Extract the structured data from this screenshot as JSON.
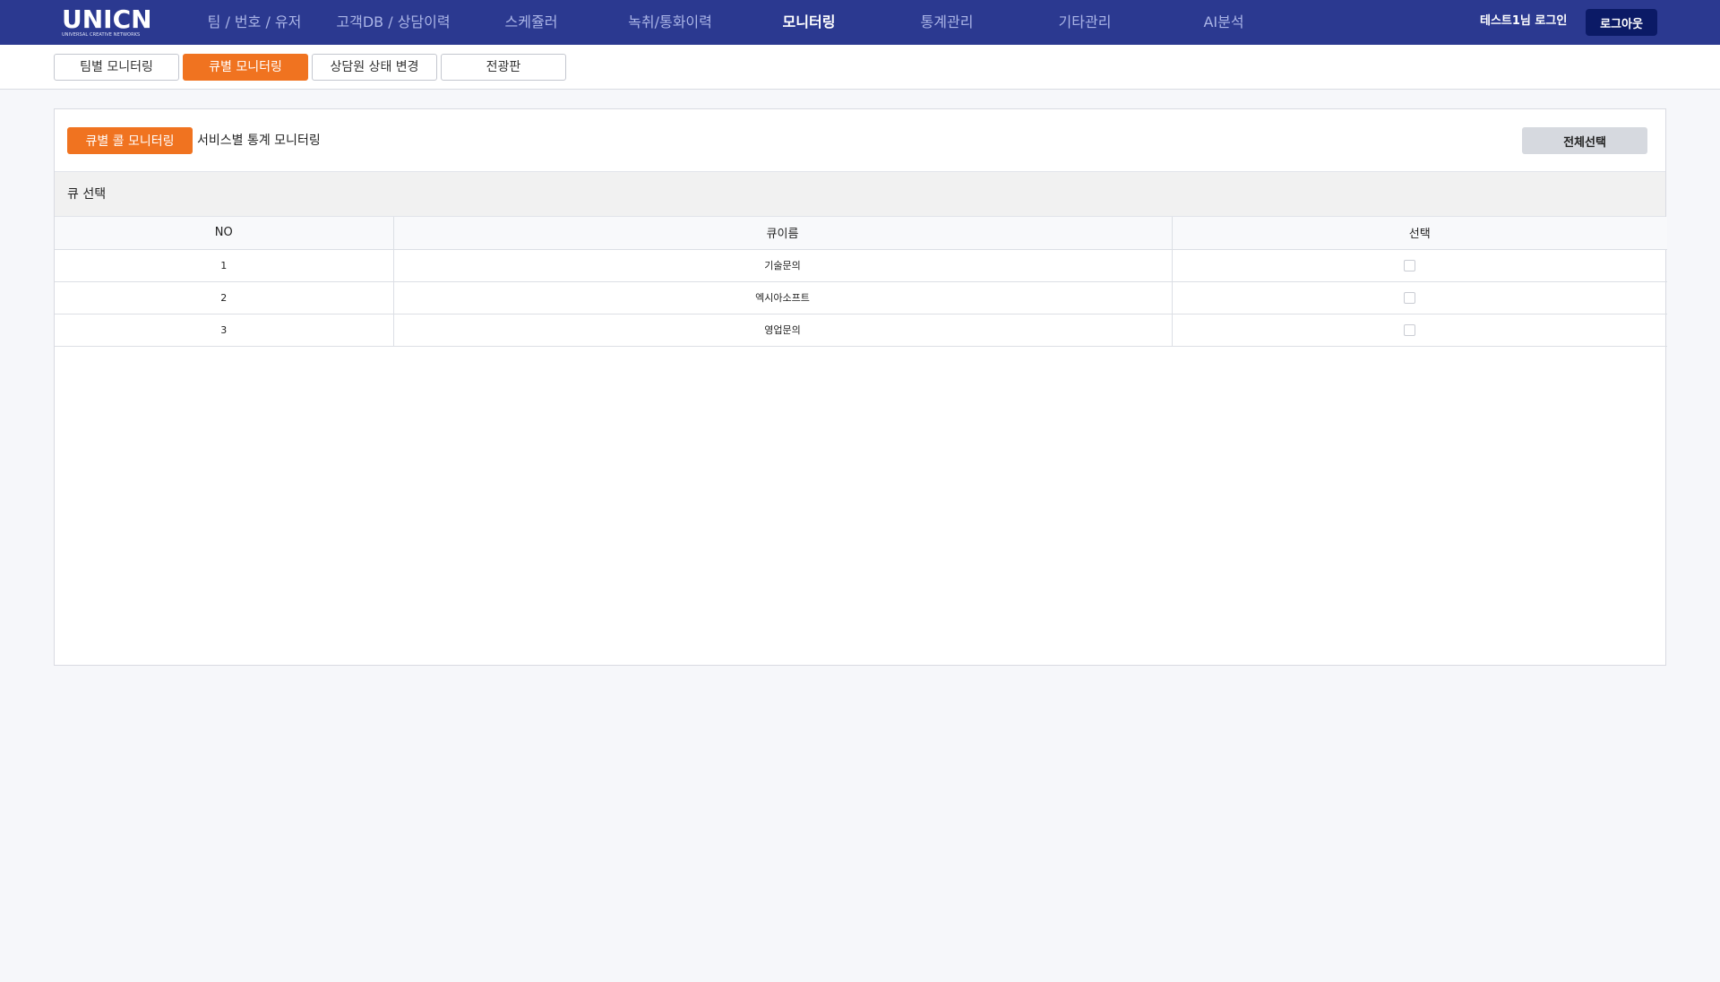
{
  "brand": {
    "logo_text": "UNICN",
    "logo_subtitle": "UNIVERSAL CREATIVE NETWORKS"
  },
  "nav": {
    "items": [
      {
        "label": "팀 / 번호 / 유저"
      },
      {
        "label": "고객DB / 상담이력"
      },
      {
        "label": "스케쥴러"
      },
      {
        "label": "녹취/통화이력"
      },
      {
        "label": "모니터링"
      },
      {
        "label": "통계관리"
      },
      {
        "label": "기타관리"
      },
      {
        "label": "AI분석"
      }
    ],
    "active": "모니터링",
    "login_text": "테스트1님 로그인",
    "logout_label": "로그아웃"
  },
  "subtabs": {
    "items": [
      {
        "label": "팀별 모니터링"
      },
      {
        "label": "큐별 모니터링"
      },
      {
        "label": "상담원 상태 변경"
      },
      {
        "label": "전광판"
      }
    ],
    "active": "큐별 모니터링"
  },
  "panel": {
    "inner_tab_active": "큐별 콜 모니터링",
    "inner_tab": "서비스별 통계 모니터링",
    "select_all_label": "전체선택",
    "section_title": "큐 선택",
    "table": {
      "headers": [
        "NO",
        "큐이름",
        "선택"
      ],
      "rows": [
        {
          "no": "1",
          "name": "기술문의",
          "checked": false
        },
        {
          "no": "2",
          "name": "엑시아소프트",
          "checked": false
        },
        {
          "no": "3",
          "name": "영업문의",
          "checked": false
        }
      ]
    }
  },
  "colors": {
    "nav_bg": "#2b3990",
    "accent": "#f07320",
    "logout_bg": "#0b1a66"
  }
}
